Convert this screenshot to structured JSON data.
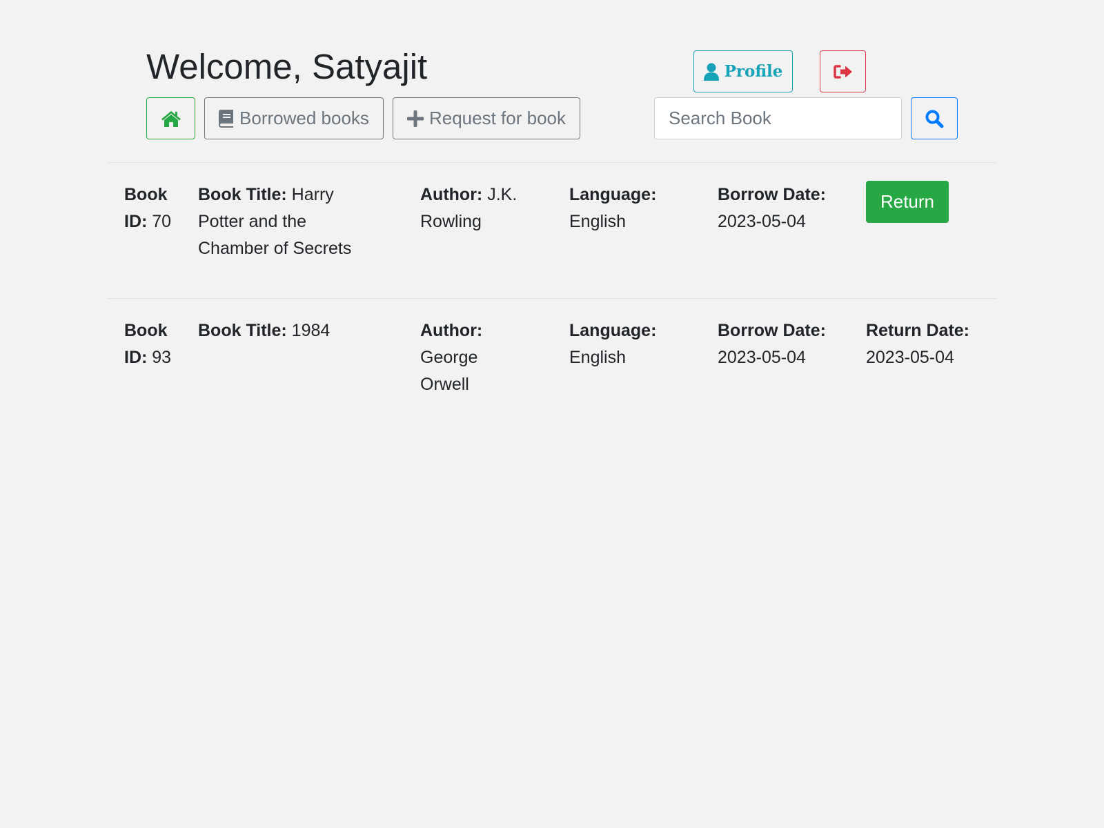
{
  "header": {
    "welcome_text": "Welcome, Satyajit",
    "profile_label": "Profile",
    "borrowed_label": "Borrowed books",
    "request_label": "Request for book",
    "search_placeholder": "Search Book"
  },
  "labels": {
    "book_id": "Book ID:",
    "book_title": "Book Title:",
    "author": "Author:",
    "language": "Language:",
    "borrow_date": "Borrow Date:",
    "return_date": "Return Date:",
    "return_button": "Return"
  },
  "books": [
    {
      "id": "70",
      "title": "Harry Potter and the Chamber of Secrets",
      "author": "J.K. Rowling",
      "language": "English",
      "borrow_date": "2023-05-04",
      "return_date": null
    },
    {
      "id": "93",
      "title": "1984",
      "author": "George Orwell",
      "language": "English",
      "borrow_date": "2023-05-04",
      "return_date": "2023-05-04"
    }
  ],
  "icons": {
    "profile": "user-icon",
    "logout": "sign-out-icon",
    "home": "home-icon",
    "borrowed": "book-icon",
    "request": "plus-icon",
    "search": "search-icon"
  },
  "colors": {
    "background": "#f2f2f2",
    "success": "#28a745",
    "info": "#17a2b8",
    "danger": "#dc3545",
    "primary": "#007bff",
    "secondary": "#6c757d"
  }
}
